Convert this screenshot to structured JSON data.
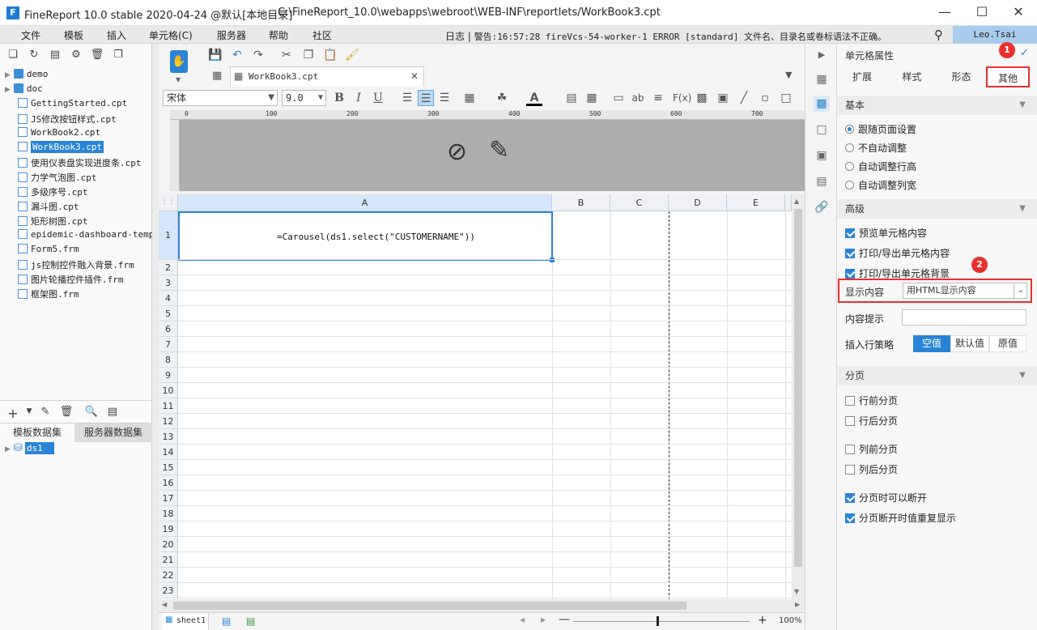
{
  "window": {
    "title": "FineReport 10.0 stable 2020-04-24 @默认[本地目录]",
    "path": "C:\\FineReport_10.0\\webapps\\webroot\\WEB-INF\\reportlets/WorkBook3.cpt",
    "logo": "F"
  },
  "menu": {
    "items": [
      "文件",
      "模板",
      "插入",
      "单元格(C)",
      "服务器",
      "帮助",
      "社区"
    ],
    "log_label": "日志",
    "log_text": "警告:16:57:28 fireVcs-54-worker-1 ERROR [standard] 文件名、目录名或卷标语法不正确。",
    "user": "Leo.Tsai"
  },
  "files": [
    {
      "name": "demo",
      "type": "folder"
    },
    {
      "name": "doc",
      "type": "folder"
    },
    {
      "name": "GettingStarted.cpt",
      "type": "file"
    },
    {
      "name": "JS修改按钮样式.cpt",
      "type": "file"
    },
    {
      "name": "WorkBook2.cpt",
      "type": "file"
    },
    {
      "name": "WorkBook3.cpt",
      "type": "file",
      "selected": true
    },
    {
      "name": "使用仪表盘实现进度条.cpt",
      "type": "file"
    },
    {
      "name": "力学气泡图.cpt",
      "type": "file"
    },
    {
      "name": "多级序号.cpt",
      "type": "file"
    },
    {
      "name": "漏斗图.cpt",
      "type": "file"
    },
    {
      "name": "矩形树图.cpt",
      "type": "file"
    },
    {
      "name": "epidemic-dashboard-temp.",
      "type": "file"
    },
    {
      "name": "Form5.frm",
      "type": "file"
    },
    {
      "name": "js控制控件融入背景.frm",
      "type": "file"
    },
    {
      "name": "图片轮播控件插件.frm",
      "type": "file"
    },
    {
      "name": "框架图.frm",
      "type": "file"
    }
  ],
  "dataset": {
    "tab_template": "模板数据集",
    "tab_server": "服务器数据集",
    "items": [
      "ds1"
    ]
  },
  "editor": {
    "tab_name": "WorkBook3.cpt",
    "font": "宋体",
    "font_size": "9.0",
    "ruler_ticks": [
      "0",
      "100",
      "200",
      "300",
      "400",
      "500",
      "600",
      "700"
    ],
    "columns": [
      "A",
      "B",
      "C",
      "D",
      "E"
    ],
    "rows": [
      "1",
      "2",
      "3",
      "4",
      "5",
      "6",
      "7",
      "8",
      "9",
      "10",
      "11",
      "12",
      "13",
      "14",
      "15",
      "16",
      "17",
      "18",
      "19",
      "20",
      "21",
      "22",
      "23"
    ],
    "cell_a1": "=Carousel(ds1.select(\"CUSTOMERNAME\"))",
    "sheet": "sheet1",
    "zoom": "100%"
  },
  "props": {
    "header": "单元格属性",
    "tabs": [
      "扩展",
      "样式",
      "形态",
      "其他"
    ],
    "active_tab": "其他",
    "basic": {
      "title": "基本",
      "options": [
        "跟随页面设置",
        "不自动调整",
        "自动调整行高",
        "自动调整列宽"
      ]
    },
    "advanced": {
      "title": "高级",
      "checks": [
        "预览单元格内容",
        "打印/导出单元格内容",
        "打印/导出单元格背景"
      ],
      "display_label": "显示内容",
      "display_value": "用HTML显示内容",
      "tip_label": "内容提示",
      "tip_value": "",
      "insert_label": "插入行策略",
      "insert_options": [
        "空值",
        "默认值",
        "原值"
      ]
    },
    "paging": {
      "title": "分页",
      "checks": [
        "行前分页",
        "行后分页",
        "列前分页",
        "列后分页",
        "分页时可以断开",
        "分页断开时值重复显示"
      ]
    },
    "badges": [
      "1",
      "2"
    ]
  },
  "colors": {
    "accent": "#2a84d6",
    "highlight_box": "#e8302e"
  }
}
